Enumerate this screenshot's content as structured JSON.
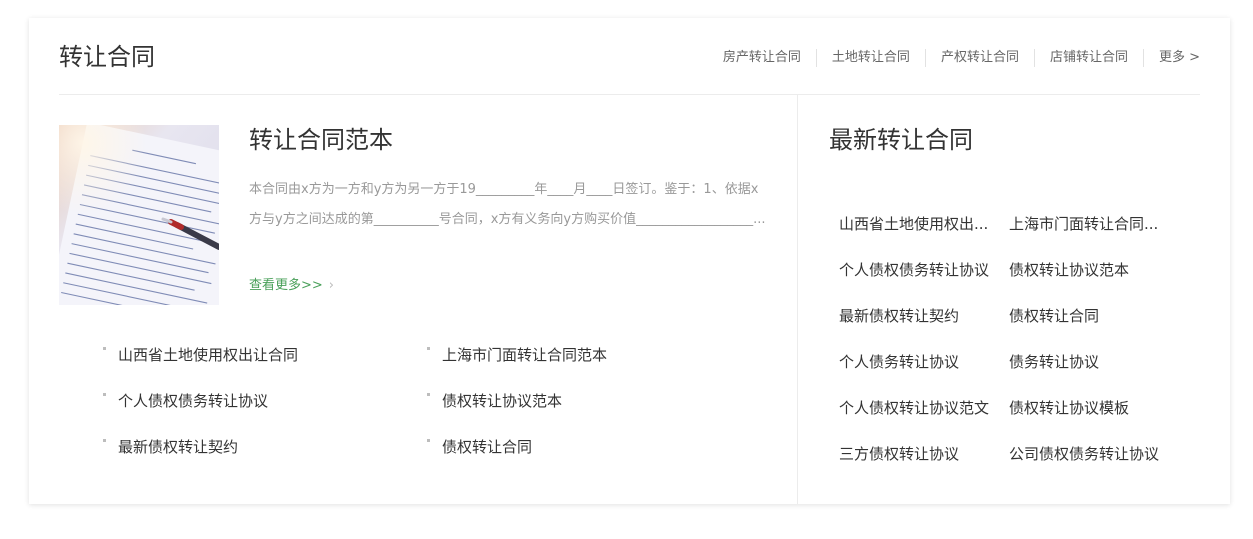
{
  "header": {
    "title": "转让合同",
    "nav": [
      "房产转让合同",
      "土地转让合同",
      "产权转让合同",
      "店铺转让合同",
      "更多 >"
    ]
  },
  "feature": {
    "title": "转让合同范本",
    "description": "本合同由x方为一方和y方为另一方于19_________年____月____日签订。鉴于：1、依据x方与y方之间达成的第__________号合同，x方有义务向y方购买价值__________________...",
    "more": "查看更多>>",
    "more_arrow": "›"
  },
  "links": [
    "山西省土地使用权出让合同",
    "上海市门面转让合同范本",
    "个人债权债务转让协议",
    "债权转让协议范本",
    "最新债权转让契约",
    "债权转让合同"
  ],
  "latest": {
    "title": "最新转让合同",
    "items": [
      "山西省土地使用权出...",
      "上海市门面转让合同...",
      "个人债权债务转让协议",
      "债权转让协议范本",
      "最新债权转让契约",
      "债权转让合同",
      "个人债务转让协议",
      "债务转让协议",
      "个人债权转让协议范文",
      "债权转让协议模板",
      "三方债权转让协议",
      "公司债权债务转让协议"
    ]
  },
  "thumbnail": {
    "icon": "contract-document-with-pen-image"
  },
  "colors": {
    "accent_link": "#4aa05a",
    "text": "#333333",
    "muted": "#999999",
    "border": "#ececec"
  }
}
